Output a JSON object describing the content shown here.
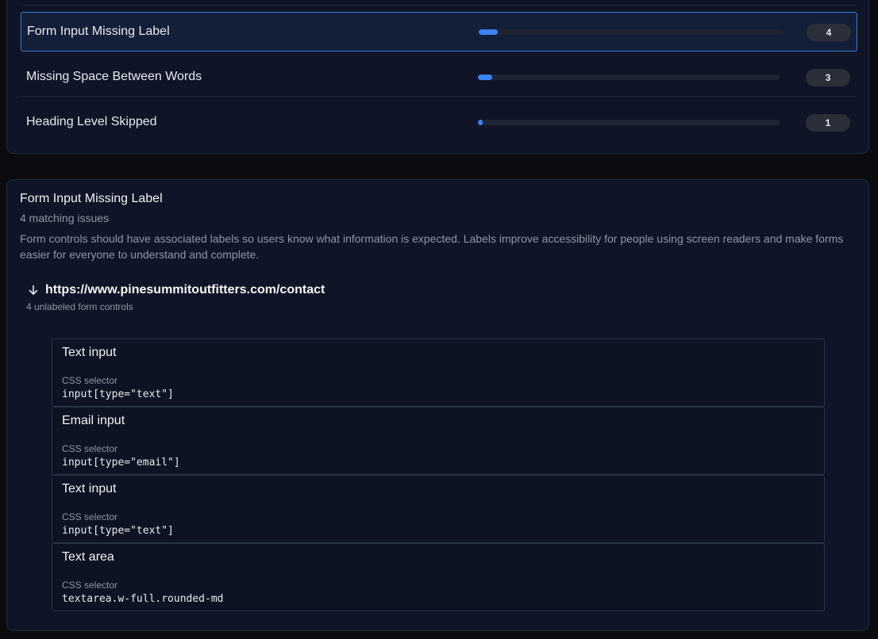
{
  "issues": [
    {
      "name": "Form Input Missing Label",
      "count": "4",
      "fraction": 0.063
    },
    {
      "name": "Missing Space Between Words",
      "count": "3",
      "fraction": 0.047
    },
    {
      "name": "Heading Level Skipped",
      "count": "1",
      "fraction": 0.016
    }
  ],
  "detail": {
    "title": "Form Input Missing Label",
    "matching": "4 matching issues",
    "description": "Form controls should have associated labels so users know what information is expected. Labels improve accessibility for people using screen readers and make forms easier for everyone to understand and complete.",
    "url_icon": "arrow-down-icon",
    "url": "https://www.pinesummitoutfitters.com/contact",
    "url_subtitle": "4 unlabeled form controls",
    "controls": [
      {
        "title": "Text input",
        "selector_label": "CSS selector",
        "selector": "input[type=\"text\"]"
      },
      {
        "title": "Email input",
        "selector_label": "CSS selector",
        "selector": "input[type=\"email\"]"
      },
      {
        "title": "Text input",
        "selector_label": "CSS selector",
        "selector": "input[type=\"text\"]"
      },
      {
        "title": "Text area",
        "selector_label": "CSS selector",
        "selector": "textarea.w-full.rounded-md"
      }
    ]
  },
  "colors": {
    "accent": "#3b82f6",
    "selected_border": "#3f79d6",
    "panel_bg": "#0f1526"
  }
}
